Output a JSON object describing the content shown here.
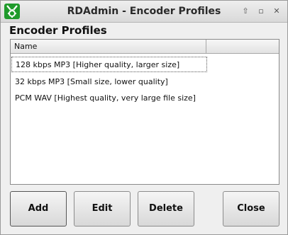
{
  "window": {
    "title": "RDAdmin - Encoder Profiles"
  },
  "titlebar_buttons": {
    "up": "⇧",
    "maximize": "▫",
    "close": "✕"
  },
  "heading": "Encoder Profiles",
  "list": {
    "columns": [
      "Name",
      ""
    ],
    "rows": [
      "128 kbps MP3 [Higher quality, larger size]",
      "32 kbps MP3 [Small size, lower quality]",
      "PCM WAV [Highest quality, very large file size]"
    ],
    "selected_index": 0
  },
  "buttons": {
    "add": "Add",
    "edit": "Edit",
    "delete": "Delete",
    "close": "Close"
  },
  "colors": {
    "icon_green": "#1f9a2b"
  }
}
